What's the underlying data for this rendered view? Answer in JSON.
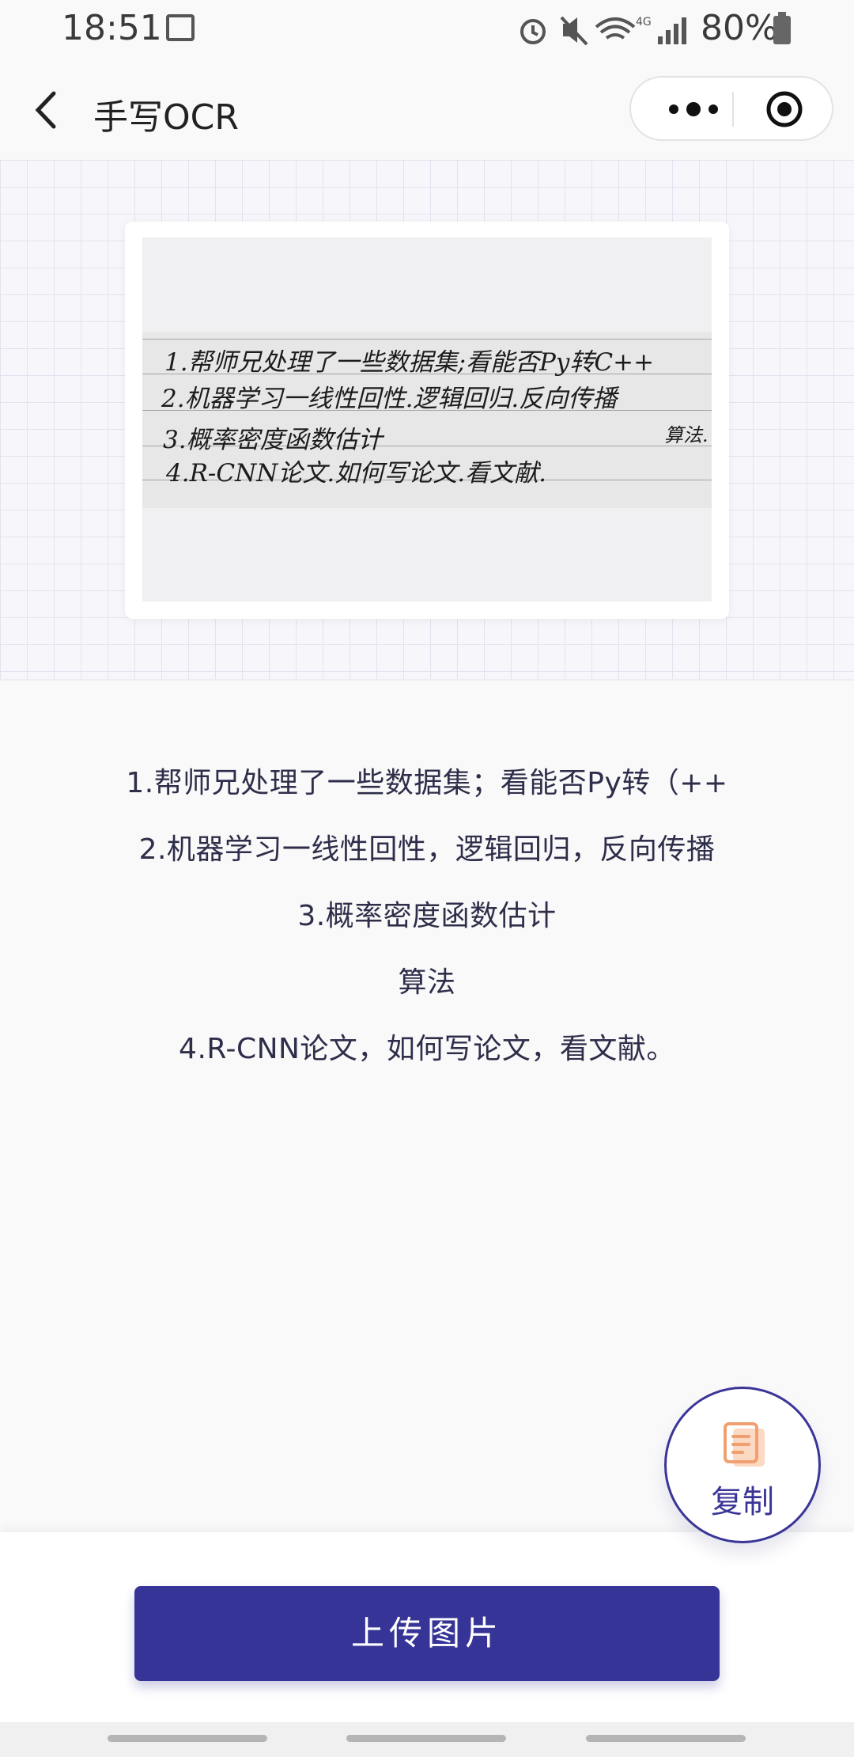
{
  "status_bar": {
    "time": "18:51",
    "network": "4G",
    "battery": "80%",
    "icons": [
      "image-icon",
      "alarm-icon",
      "mute-icon",
      "wifi-icon",
      "signal-icon",
      "battery-icon"
    ]
  },
  "header": {
    "title": "手写OCR",
    "back_icon": "chevron-left-icon",
    "more_icon": "more-dots-icon",
    "close_icon": "target-icon"
  },
  "photo": {
    "handwritten_lines": [
      "1.帮师兄处理了一些数据集;看能否Py转C++",
      "2.机器学习一线性回性.逻辑回归.反向传播",
      "3.概率密度函数估计",
      "算法.",
      "4.R-CNN论文.如何写论文.看文献."
    ]
  },
  "result": {
    "lines": [
      "1.帮师兄处理了一些数据集；看能否Py转（++",
      "2.机器学习一线性回性，逻辑回归，反向传播",
      "3.概率密度函数估计",
      "算法",
      "4.R-CNN论文，如何写论文，看文献。"
    ]
  },
  "copy_button": {
    "label": "复制",
    "icon": "copy-document-icon"
  },
  "upload_button": {
    "label": "上传图片"
  },
  "colors": {
    "accent": "#363496",
    "copy_icon": "#f0a070",
    "text": "#2e2e4a"
  }
}
